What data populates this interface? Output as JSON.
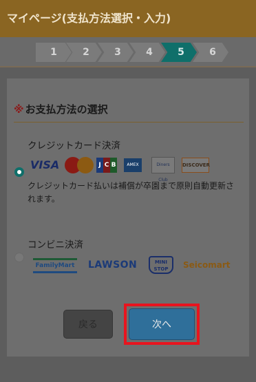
{
  "header": {
    "title": "マイページ(支払方法選択・入力)"
  },
  "steps": [
    {
      "label": "1",
      "active": false
    },
    {
      "label": "2",
      "active": false
    },
    {
      "label": "3",
      "active": false
    },
    {
      "label": "4",
      "active": false
    },
    {
      "label": "5",
      "active": true
    },
    {
      "label": "6",
      "active": false
    }
  ],
  "colors": {
    "header": "#8a6522",
    "step_inactive": "#7b7b7b",
    "step_active": "#0f6f6a",
    "next_button": "#2f6f9a",
    "highlight": "#e8141e"
  },
  "section": {
    "mark": "※",
    "title": "お支払方法の選択"
  },
  "options": {
    "credit": {
      "label": "クレジットカード決済",
      "selected": true,
      "brands": {
        "visa": "VISA",
        "jcb": [
          "J",
          "C",
          "B"
        ],
        "amex": "AMEX",
        "diners": "Diners Club",
        "discover": "DISCOVER"
      },
      "description": "クレジットカード払いは補償が卒園まで原則自動更新されます。"
    },
    "convenience": {
      "label": "コンビニ決済",
      "selected": false,
      "brands": {
        "familymart": "FamilyMart",
        "lawson": "LAWSON",
        "ministop": [
          "MINI",
          "STOP"
        ],
        "seicomart": "Seicomart"
      }
    }
  },
  "buttons": {
    "back": "戻る",
    "next": "次へ"
  }
}
